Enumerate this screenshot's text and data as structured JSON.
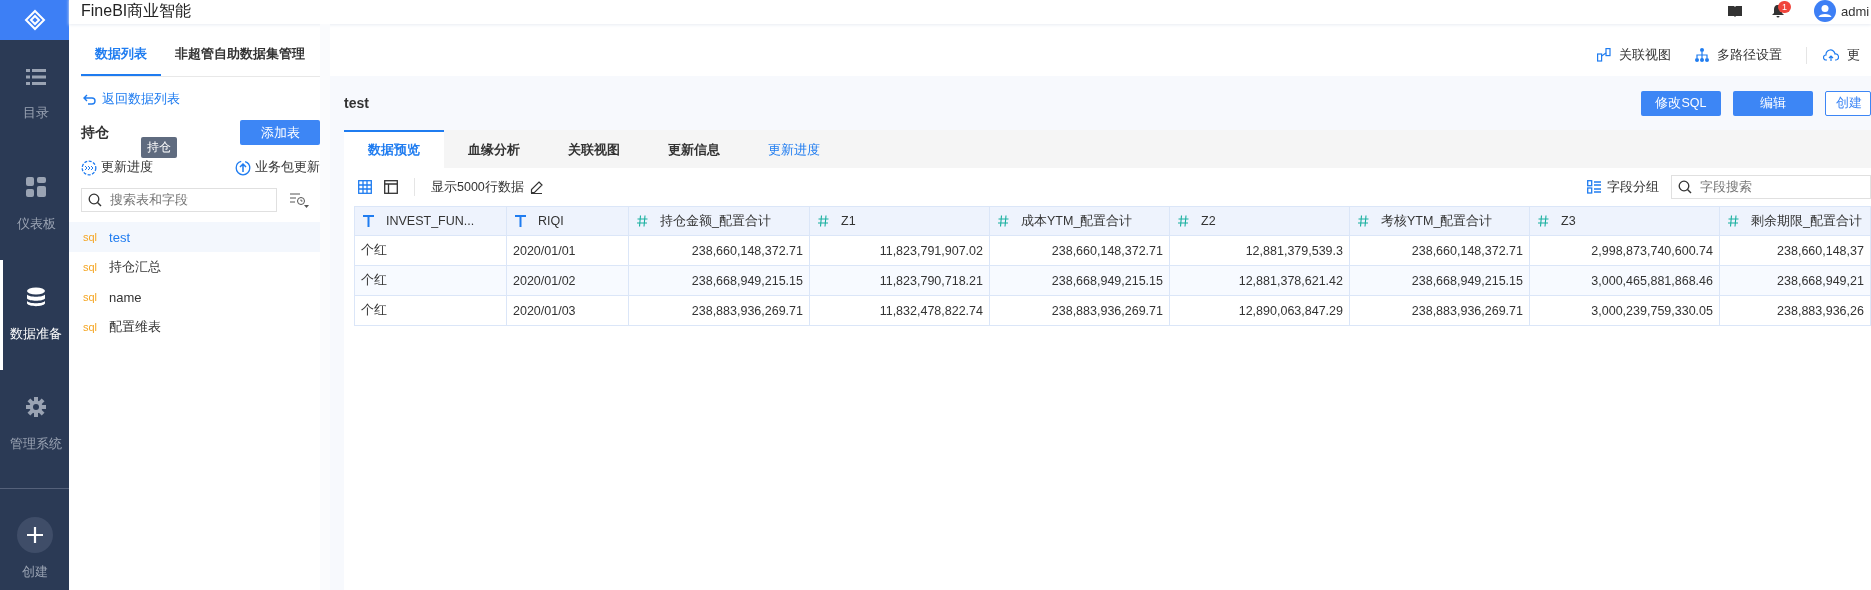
{
  "app": {
    "title": "FineBI商业智能"
  },
  "header": {
    "notification_count": "1",
    "user": "admi"
  },
  "sidebar": {
    "items": [
      {
        "label": "目录",
        "kind": "list",
        "selected": false
      },
      {
        "label": "仪表板",
        "kind": "dashboard",
        "selected": false
      },
      {
        "label": "数据准备",
        "kind": "database",
        "selected": true
      },
      {
        "label": "管理系统",
        "kind": "gear",
        "selected": false
      }
    ],
    "create": {
      "label": "创建"
    }
  },
  "left_panel": {
    "tabs": [
      {
        "label": "数据列表",
        "selected": true
      },
      {
        "label": "非超管自助数据集管理",
        "selected": false
      }
    ],
    "back_link": "返回数据列表",
    "package_title": "持仓",
    "add_button": "添加表",
    "update_progress": "更新进度",
    "tooltip": "持仓",
    "package_update": "业务包更新",
    "search": {
      "placeholder": "搜索表和字段"
    },
    "tables": [
      {
        "type": "sql",
        "name": "test",
        "selected": true
      },
      {
        "type": "sql",
        "name": "持仓汇总",
        "selected": false
      },
      {
        "type": "sql",
        "name": "name",
        "selected": false
      },
      {
        "type": "sql",
        "name": "配置维表",
        "selected": false
      }
    ]
  },
  "top_actions": [
    {
      "label": "关联视图",
      "kind": "relation"
    },
    {
      "label": "多路径设置",
      "kind": "tree"
    },
    {
      "label": "更",
      "kind": "cloud"
    }
  ],
  "detail": {
    "title": "test",
    "buttons": [
      {
        "label": "修改SQL",
        "kind": "primary"
      },
      {
        "label": "编辑",
        "kind": "primary"
      },
      {
        "label": "创建",
        "kind": "outline"
      }
    ],
    "tabs": [
      {
        "label": "数据预览",
        "selected": true,
        "kind": "normal"
      },
      {
        "label": "血缘分析",
        "selected": false,
        "kind": "normal"
      },
      {
        "label": "关联视图",
        "selected": false,
        "kind": "normal"
      },
      {
        "label": "更新信息",
        "selected": false,
        "kind": "normal"
      },
      {
        "label": "更新进度",
        "selected": false,
        "kind": "link"
      }
    ],
    "view_modes": [
      {
        "kind": "grid",
        "selected": true
      },
      {
        "kind": "layout",
        "selected": false
      }
    ],
    "row_limit": "显示5000行数据",
    "field_group": "字段分组",
    "field_search": {
      "placeholder": "字段搜索"
    }
  },
  "table": {
    "columns": [
      {
        "label": "INVEST_FUN...",
        "kind": "text"
      },
      {
        "label": "RIQI",
        "kind": "text"
      },
      {
        "label": "持仓金额_配置合计",
        "kind": "number"
      },
      {
        "label": "Z1",
        "kind": "number"
      },
      {
        "label": "成本YTM_配置合计",
        "kind": "number"
      },
      {
        "label": "Z2",
        "kind": "number"
      },
      {
        "label": "考核YTM_配置合计",
        "kind": "number"
      },
      {
        "label": "Z3",
        "kind": "number"
      },
      {
        "label": "剩余期限_配置合计",
        "kind": "number"
      }
    ],
    "rows": [
      [
        "个红",
        "2020/01/01",
        "238,660,148,372.71",
        "11,823,791,907.02",
        "238,660,148,372.71",
        "12,881,379,539.3",
        "238,660,148,372.71",
        "2,998,873,740,600.74",
        "238,660,148,37"
      ],
      [
        "个红",
        "2020/01/02",
        "238,668,949,215.15",
        "11,823,790,718.21",
        "238,668,949,215.15",
        "12,881,378,621.42",
        "238,668,949,215.15",
        "3,000,465,881,868.46",
        "238,668,949,21"
      ],
      [
        "个红",
        "2020/01/03",
        "238,883,936,269.71",
        "11,832,478,822.74",
        "238,883,936,269.71",
        "12,890,063,847.29",
        "238,883,936,269.71",
        "3,000,239,759,330.05",
        "238,883,936,26"
      ]
    ]
  }
}
